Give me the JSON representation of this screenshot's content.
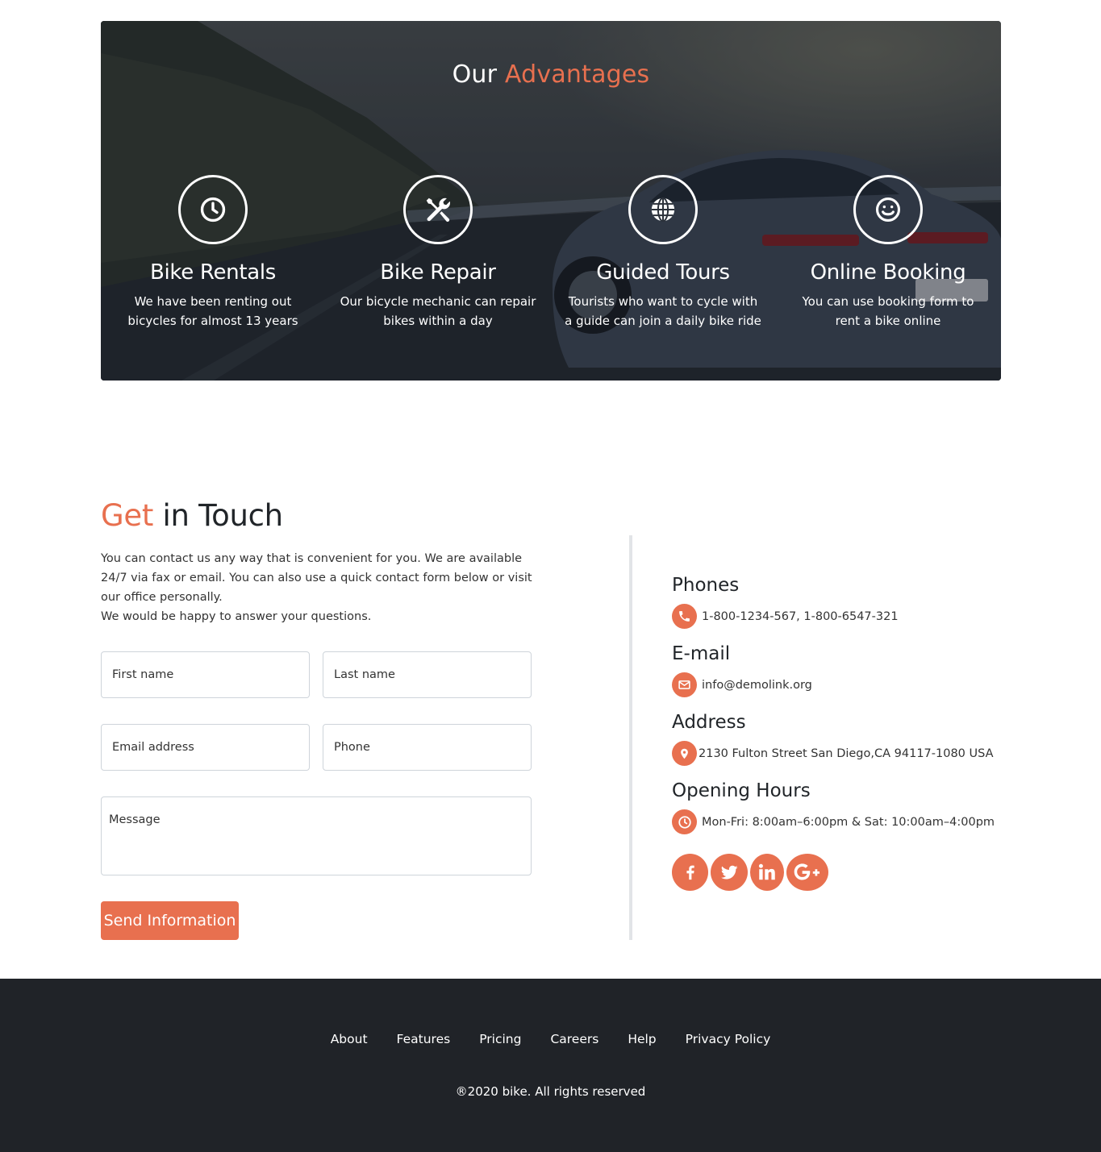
{
  "advantages": {
    "title_a": "Our",
    "title_b": "Advantages",
    "features": [
      {
        "title": "Bike Rentals",
        "desc": "We have been renting out bicycles for almost 13 years",
        "icon": "clock-icon"
      },
      {
        "title": "Bike Repair",
        "desc": "Our bicycle mechanic can repair bikes within a day",
        "icon": "tools-icon"
      },
      {
        "title": "Guided Tours",
        "desc": "Tourists who want to cycle with a guide can join a daily bike ride",
        "icon": "globe-icon"
      },
      {
        "title": "Online Booking",
        "desc": "You can use booking form to rent a bike online",
        "icon": "smiley-icon"
      }
    ]
  },
  "touch": {
    "title_a": "Get",
    "title_b": "in Touch",
    "desc_line1": "You can contact us any way that is convenient for you. We are available 24/7 via fax or email. You can also use a quick contact form below or visit our office personally.",
    "desc_line2": "We would be happy to answer your questions.",
    "form": {
      "first_name": "First name",
      "last_name": "Last name",
      "email": "Email address",
      "phone": "Phone",
      "message": "Message",
      "submit": "Send Information"
    }
  },
  "contact": {
    "phones_label": "Phones",
    "phones_value": "1-800-1234-567, 1-800-6547-321",
    "email_label": "E-mail",
    "email_value": "info@demolink.org",
    "address_label": "Address",
    "address_value": "2130 Fulton Street San Diego,CA 94117-1080 USA",
    "hours_label": "Opening Hours",
    "hours_value": "Mon-Fri: 8:00am–6:00pm & Sat: 10:00am–4:00pm",
    "social": [
      "facebook-icon",
      "twitter-icon",
      "linkedin-icon",
      "google-plus-icon"
    ]
  },
  "footer": {
    "nav": [
      "About",
      "Features",
      "Pricing",
      "Careers",
      "Help",
      "Privacy Policy"
    ],
    "copyright": "®2020 bike. All rights reserved"
  },
  "colors": {
    "accent": "#e8704f",
    "footer_bg": "#202328"
  }
}
